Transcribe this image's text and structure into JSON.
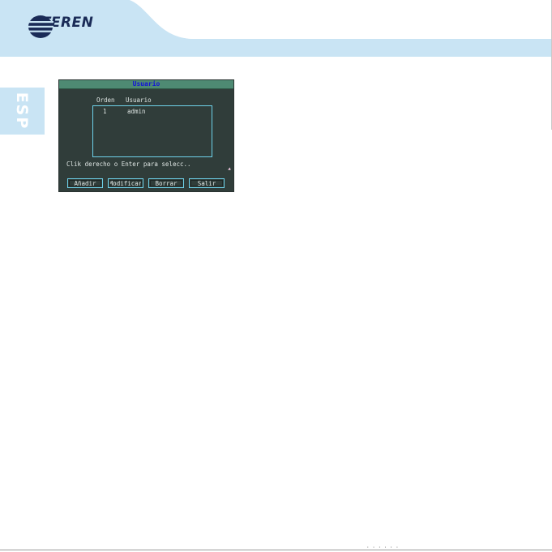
{
  "brand": {
    "name": "STEREN",
    "color": "#1a2b57",
    "header_color": "#c9e4f4"
  },
  "language_tab": {
    "label": "ESP",
    "color": "#c9e4f4"
  },
  "dvr_dialog": {
    "title": "Usuario",
    "columns": [
      "Orden",
      "Usuario"
    ],
    "rows": [
      {
        "order": "1",
        "user": "admin"
      }
    ],
    "hint": "Clik derecho o Enter para selecc..",
    "buttons": {
      "add": "Añadir",
      "modify": "Modificar",
      "delete": "Borrar",
      "exit": "Salir"
    },
    "colors": {
      "panel": "#303d3a",
      "titlebar": "#4e8a73",
      "title_text": "#1414d8",
      "border": "#6ed2ea"
    }
  },
  "footer": {
    "mark": "· · · · · ·"
  }
}
